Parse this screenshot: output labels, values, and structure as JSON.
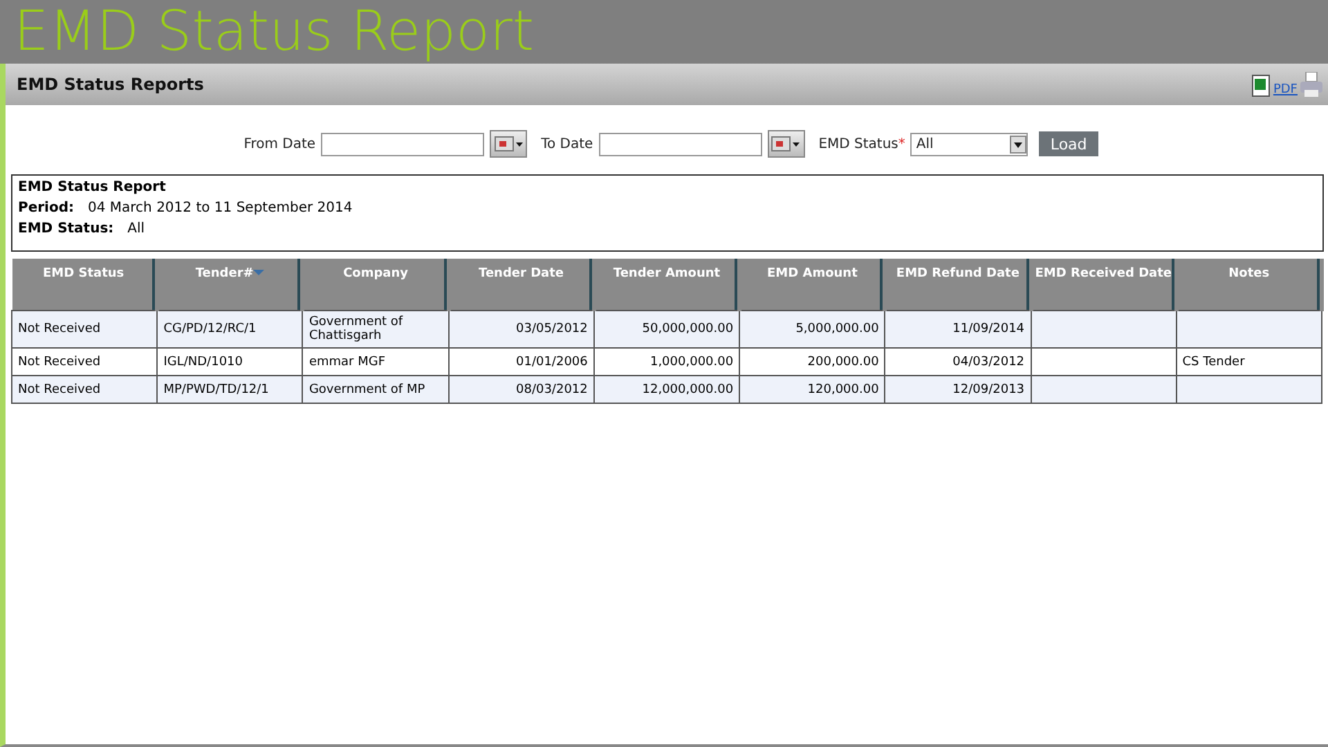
{
  "slide_title": "EMD Status Report",
  "panel": {
    "title": "EMD Status Reports",
    "export_link": "PDF"
  },
  "filters": {
    "from_date": {
      "label": "From Date"
    },
    "to_date": {
      "label": "To Date"
    },
    "status": {
      "label": "EMD Status",
      "required_mark": "*",
      "value": "All"
    },
    "load_button": "Load"
  },
  "summary": {
    "title": "EMD Status Report",
    "lines": [
      {
        "label": "Period:",
        "value": "04 March 2012 to 11 September 2014"
      },
      {
        "label": "EMD Status:",
        "value": "All"
      }
    ]
  },
  "table": {
    "columns": [
      {
        "label": "EMD Status",
        "sorted": false
      },
      {
        "label": "Tender#",
        "sorted": true
      },
      {
        "label": "Company",
        "sorted": false
      },
      {
        "label": "Tender Date",
        "sorted": false
      },
      {
        "label": "Tender Amount",
        "sorted": false
      },
      {
        "label": "EMD Amount",
        "sorted": false
      },
      {
        "label": "EMD Refund Date",
        "sorted": false
      },
      {
        "label": "EMD Received Date",
        "sorted": false
      },
      {
        "label": "Notes",
        "sorted": false
      }
    ],
    "rows": [
      [
        "Not Received",
        "CG/PD/12/RC/1",
        "Government of Chattisgarh",
        "03/05/2012",
        "50,000,000.00",
        "5,000,000.00",
        "11/09/2014",
        "",
        ""
      ],
      [
        "Not Received",
        "IGL/ND/1010",
        "emmar MGF",
        "01/01/2006",
        "1,000,000.00",
        "200,000.00",
        "04/03/2012",
        "",
        "CS Tender"
      ],
      [
        "Not Received",
        "MP/PWD/TD/12/1",
        "Government of MP",
        "08/03/2012",
        "12,000,000.00",
        "120,000.00",
        "12/09/2013",
        "",
        ""
      ]
    ]
  }
}
